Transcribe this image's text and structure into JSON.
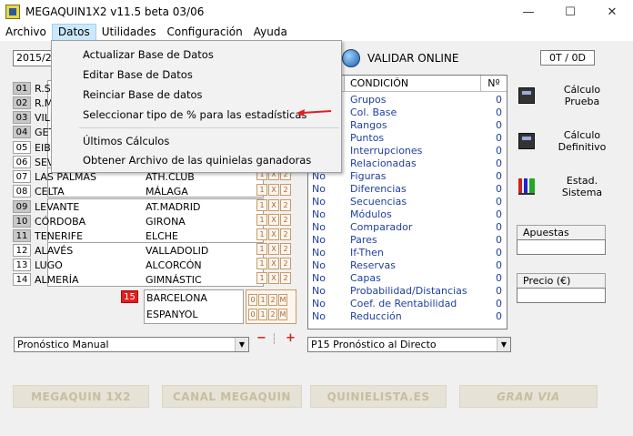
{
  "window": {
    "title": "MEGAQUIN1X2 v11.5 beta 03/06",
    "controls": {
      "minimize": "—",
      "maximize": "☐",
      "close": "✕"
    }
  },
  "menubar": {
    "items": [
      "Archivo",
      "Datos",
      "Utilidades",
      "Configuración",
      "Ayuda"
    ],
    "active": "Datos"
  },
  "datos_menu": {
    "items": [
      "Actualizar Base de Datos",
      "Editar Base de Datos",
      "Reinciar Base de datos",
      "Seleccionar tipo de % para las estadísticas",
      "Últimos Cálculos",
      "Obtener Archivo de las quinielas ganadoras"
    ]
  },
  "toolbar": {
    "season_value": "2015/2",
    "validar_label": "VALIDAR ONLINE",
    "counter": "0T / 0D"
  },
  "matches": [
    {
      "num": "01",
      "home": "R.SO",
      "away": ""
    },
    {
      "num": "02",
      "home": "R.MA",
      "away": ""
    },
    {
      "num": "03",
      "home": "VILL",
      "away": ""
    },
    {
      "num": "04",
      "home": "GET",
      "away": ""
    },
    {
      "num": "05",
      "home": "EIBA",
      "away": ""
    },
    {
      "num": "06",
      "home": "SEVI",
      "away": ""
    },
    {
      "num": "07",
      "home": "LAS PALMAS",
      "away": "ATH.CLUB"
    },
    {
      "num": "08",
      "home": "CELTA",
      "away": "MÁLAGA"
    },
    {
      "num": "09",
      "home": "LEVANTE",
      "away": "AT.MADRID"
    },
    {
      "num": "10",
      "home": "CÓRDOBA",
      "away": "GIRONA"
    },
    {
      "num": "11",
      "home": "TENERIFE",
      "away": "ELCHE"
    },
    {
      "num": "12",
      "home": "ALAVÉS",
      "away": "VALLADOLID"
    },
    {
      "num": "13",
      "home": "LUGO",
      "away": "ALCORCÓN"
    },
    {
      "num": "14",
      "home": "ALMERÍA",
      "away": "GIMNÁSTIC"
    }
  ],
  "marks": [
    "1",
    "X",
    "2"
  ],
  "pleno15": {
    "num": "15",
    "home": "BARCELONA",
    "away": "ESPANYOL",
    "goals": [
      "0",
      "1",
      "2",
      "M"
    ]
  },
  "conditions": {
    "header": {
      "condition": "CONDICIÓN",
      "count": "Nº"
    },
    "rows": [
      {
        "state": "",
        "name": "Grupos",
        "count": "0"
      },
      {
        "state": "",
        "name": "Col. Base",
        "count": "0"
      },
      {
        "state": "",
        "name": "Rangos",
        "count": "0"
      },
      {
        "state": "",
        "name": "Puntos",
        "count": "0"
      },
      {
        "state": "",
        "name": "Interrupciones",
        "count": "0"
      },
      {
        "state": "",
        "name": "Relacionadas",
        "count": "0"
      },
      {
        "state": "No",
        "name": "Figuras",
        "count": "0"
      },
      {
        "state": "No",
        "name": "Diferencias",
        "count": "0"
      },
      {
        "state": "No",
        "name": "Secuencias",
        "count": "0"
      },
      {
        "state": "No",
        "name": "Módulos",
        "count": "0"
      },
      {
        "state": "No",
        "name": "Comparador",
        "count": "0"
      },
      {
        "state": "No",
        "name": "Pares",
        "count": "0"
      },
      {
        "state": "No",
        "name": "If-Then",
        "count": "0"
      },
      {
        "state": "No",
        "name": "Reservas",
        "count": "0"
      },
      {
        "state": "No",
        "name": "Capas",
        "count": "0"
      },
      {
        "state": "No",
        "name": "Probabilidad/Distancias",
        "count": "0"
      },
      {
        "state": "No",
        "name": "Coef. de Rentabilidad",
        "count": "0"
      },
      {
        "state": "No",
        "name": "Reducción",
        "count": "0"
      }
    ]
  },
  "side": {
    "calc_prueba": "Cálculo Prueba",
    "calc_definitivo": "Cálculo Definitivo",
    "estad_sistema": "Estad. Sistema",
    "apuestas_label": "Apuestas",
    "apuestas_value": "",
    "precio_label": "Precio (€)",
    "precio_value": ""
  },
  "selects": {
    "pronostico": "Pronóstico Manual",
    "p15": "P15 Pronóstico al Directo"
  },
  "mini_controls": {
    "minus": "−",
    "plus": "+"
  },
  "brands": [
    "MEGAQUIN 1X2",
    "CANAL MEGAQUIN",
    "QUINIELISTA.ES",
    "GRAN VIA"
  ],
  "colors": {
    "accent_red": "#e02020",
    "condition_blue": "#1f3f9f",
    "menu_highlight": "#cce8ff"
  }
}
